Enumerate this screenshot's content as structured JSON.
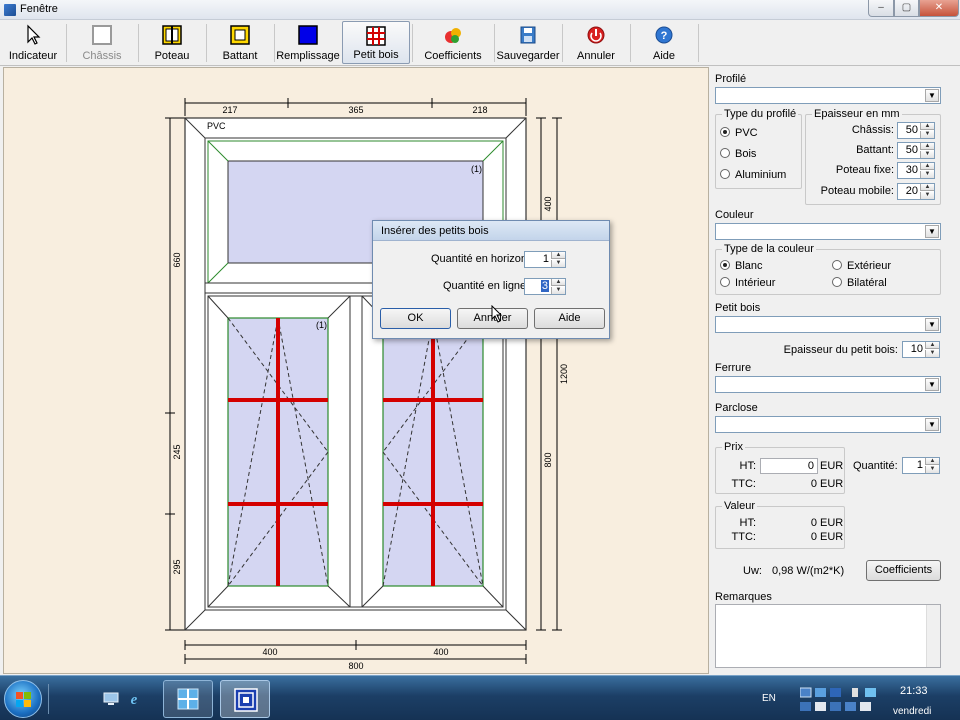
{
  "window": {
    "title": "Fenêtre",
    "min_symbol": "–",
    "max_symbol": "▢",
    "close_symbol": "✕"
  },
  "toolbar": {
    "items": [
      {
        "label": "Indicateur",
        "icon": "pointer-icon"
      },
      {
        "label": "Châssis",
        "icon": "frame-icon",
        "disabled": true
      },
      {
        "label": "Poteau",
        "icon": "post-icon"
      },
      {
        "label": "Battant",
        "icon": "sash-icon"
      },
      {
        "label": "Remplissage",
        "icon": "fill-icon"
      },
      {
        "label": "Petit bois",
        "icon": "grid-icon",
        "active": true
      },
      {
        "label": "Coefficients",
        "icon": "coefficients-icon"
      },
      {
        "label": "Sauvegarder",
        "icon": "save-icon"
      },
      {
        "label": "Annuler",
        "icon": "cancel-icon"
      },
      {
        "label": "Aide",
        "icon": "help-icon"
      }
    ]
  },
  "drawing": {
    "material": "PVC",
    "marker_left": "(1)",
    "marker_top": "(1)",
    "top_dims": [
      "217",
      "365",
      "218"
    ],
    "bottom_dims": [
      "400",
      "400"
    ],
    "total_width": "800",
    "left_dims": [
      "660",
      "245",
      "295"
    ],
    "right_dims": [
      "400",
      "1200",
      "800"
    ]
  },
  "dialog": {
    "title": "Insérer des petits bois",
    "horizontal_label": "Quantité en horizon",
    "horizontal_value": "1",
    "line_label": "Quantité en ligne",
    "line_value": "3",
    "ok": "OK",
    "cancel": "Annuler",
    "help": "Aide"
  },
  "panel": {
    "profile_label": "Profilé",
    "profile_type": {
      "title": "Type du profilé",
      "options": [
        "PVC",
        "Bois",
        "Aluminium"
      ],
      "selected": "PVC"
    },
    "thickness": {
      "title": "Epaisseur en mm",
      "rows": [
        {
          "label": "Châssis:",
          "value": "50"
        },
        {
          "label": "Battant:",
          "value": "50"
        },
        {
          "label": "Poteau fixe:",
          "value": "30"
        },
        {
          "label": "Poteau mobile:",
          "value": "20"
        }
      ]
    },
    "color_label": "Couleur",
    "color_type": {
      "title": "Type de la couleur",
      "options": [
        "Blanc",
        "Extérieur",
        "Intérieur",
        "Bilatéral"
      ],
      "selected": "Blanc"
    },
    "muntin_label": "Petit bois",
    "muntin_thickness_label": "Epaisseur du petit bois:",
    "muntin_thickness_value": "10",
    "hardware_label": "Ferrure",
    "bead_label": "Parclose",
    "price": {
      "title": "Prix",
      "ht_label": "HT:",
      "ht_value": "0",
      "ht_unit": "EUR",
      "ttc_label": "TTC:",
      "ttc_value": "0",
      "ttc_unit": "EUR"
    },
    "quantity_label": "Quantité:",
    "quantity_value": "1",
    "value": {
      "title": "Valeur",
      "ht_label": "HT:",
      "ht_value": "0",
      "ht_unit": "EUR",
      "ttc_label": "TTC:",
      "ttc_value": "0",
      "ttc_unit": "EUR"
    },
    "uw_label": "Uw:",
    "uw_value": "0,98 W/(m2*K)",
    "coefficients_button": "Coefficients",
    "remarks_label": "Remarques"
  },
  "taskbar": {
    "lang": "EN",
    "time": "21:33",
    "day": "vendredi"
  }
}
